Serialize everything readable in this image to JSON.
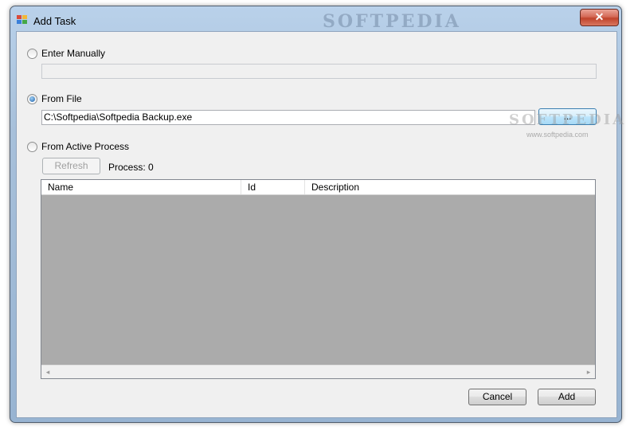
{
  "window": {
    "title": "Add Task",
    "close_glyph": "✕"
  },
  "options": {
    "manual": {
      "label": "Enter Manually",
      "checked": false,
      "value": ""
    },
    "file": {
      "label": "From File",
      "checked": true,
      "value": "C:\\Softpedia\\Softpedia Backup.exe",
      "browse_label": "..."
    },
    "process": {
      "label": "From Active Process",
      "checked": false,
      "refresh_label": "Refresh",
      "process_count": "Process: 0"
    }
  },
  "table": {
    "columns": [
      "Name",
      "Id",
      "Description"
    ],
    "rows": [],
    "scroll_left": "◂",
    "scroll_right": "▸"
  },
  "buttons": {
    "cancel": "Cancel",
    "add": "Add"
  },
  "watermarks": {
    "title_bar": "SOFTPEDIA",
    "mark": "SOFTPEDIA",
    "url": "www.softpedia.com"
  },
  "colors": {
    "background": "#f0f0f0",
    "list_empty": "#ababab",
    "accent": "#3c7fb1"
  },
  "icons": {
    "app": "app-icon",
    "close": "close-icon"
  }
}
